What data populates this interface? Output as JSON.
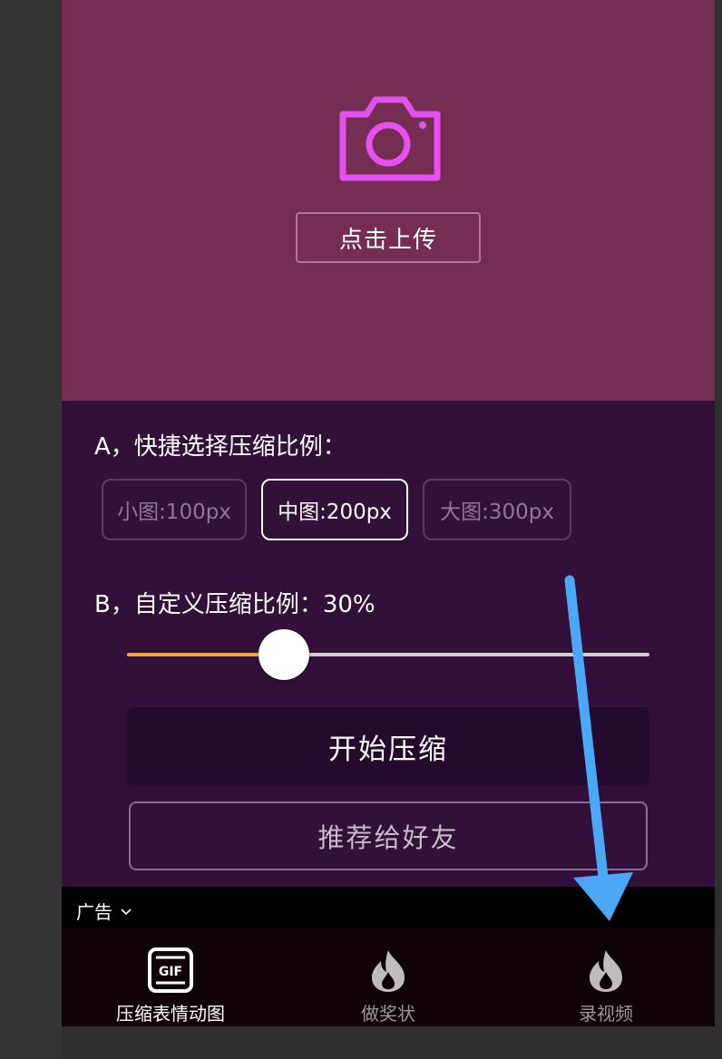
{
  "upload": {
    "icon": "camera-icon",
    "button_label": "点击上传",
    "accent_color": "#e352f0"
  },
  "section_a": {
    "title": "A，快捷选择压缩比例：",
    "presets": [
      {
        "label": "小图:100px",
        "selected": false
      },
      {
        "label": "中图:200px",
        "selected": true
      },
      {
        "label": "大图:300px",
        "selected": false
      }
    ]
  },
  "section_b": {
    "title": "B，自定义压缩比例：30%",
    "slider_value_percent": 30,
    "fill_color": "#f0a93a"
  },
  "actions": {
    "start_label": "开始压缩",
    "share_label": "推荐给好友"
  },
  "ad": {
    "label": "广告"
  },
  "tabs": [
    {
      "label": "压缩表情动图",
      "icon": "gif-icon",
      "active": true
    },
    {
      "label": "做奖状",
      "icon": "flame-icon",
      "active": false
    },
    {
      "label": "录视频",
      "icon": "flame-icon",
      "active": false
    }
  ],
  "overlay": {
    "arrow_color": "#4aa8f5",
    "icon": "annotation-arrow-icon"
  }
}
